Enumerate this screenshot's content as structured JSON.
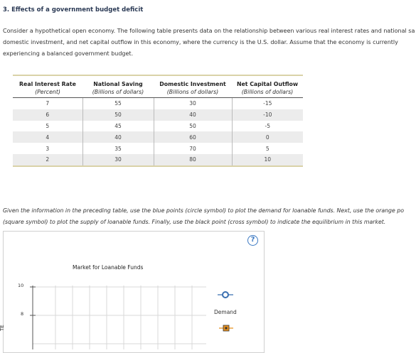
{
  "header": {
    "title": "3. Effects of a government budget deficit"
  },
  "intro": {
    "lines": [
      "Consider a hypothetical open economy. The following table presents data on the relationship between various real interest rates and national sa",
      "domestic investment, and net capital outflow in this economy, where the currency is the U.S. dollar. Assume that the economy is currently",
      "experiencing a balanced government budget."
    ]
  },
  "table": {
    "headers": [
      "Real Interest Rate",
      "National Saving",
      "Domestic Investment",
      "Net Capital Outflow"
    ],
    "subheaders": [
      "(Percent)",
      "(Billions of dollars)",
      "(Billions of dollars)",
      "(Billions of dollars)"
    ],
    "rows": [
      [
        "7",
        "55",
        "30",
        "-15"
      ],
      [
        "6",
        "50",
        "40",
        "-10"
      ],
      [
        "5",
        "45",
        "50",
        "-5"
      ],
      [
        "4",
        "40",
        "60",
        "0"
      ],
      [
        "3",
        "35",
        "70",
        "5"
      ],
      [
        "2",
        "30",
        "80",
        "10"
      ]
    ]
  },
  "instructions": {
    "lines": [
      "Given the information in the preceding table, use the blue points (circle symbol) to plot the demand for loanable funds. Next, use the orange po",
      "(square symbol) to plot the supply of loanable funds. Finally, use the black point (cross symbol) to indicate the equilibrium in this market."
    ]
  },
  "graph": {
    "help_label": "?",
    "title": "Market for Loanable Funds",
    "y_ticks": [
      "10",
      "8"
    ],
    "y_axis_label_partial": "TE",
    "legend": {
      "demand_label": "Demand"
    },
    "colors": {
      "demand": "#3a6fb0",
      "supply": "#e8911f",
      "grid": "#d8d8d8",
      "axis": "#555555"
    }
  }
}
